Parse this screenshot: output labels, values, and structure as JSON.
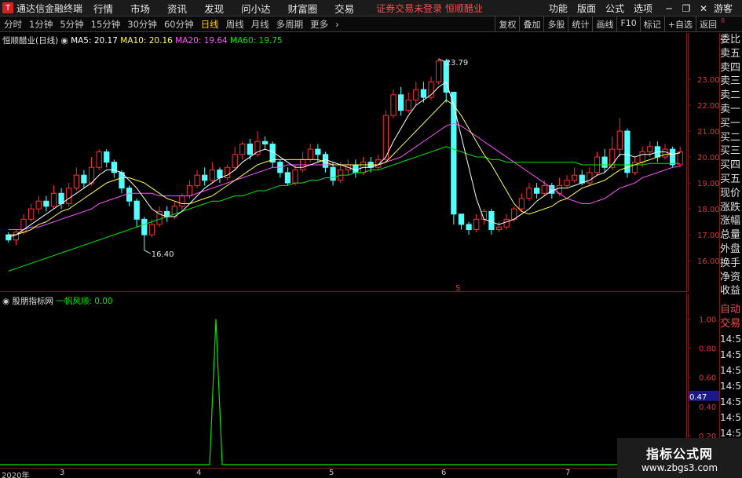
{
  "titlebar": {
    "logo": "T",
    "app_name": "通达信金融终端",
    "menus": [
      "行情",
      "市场",
      "资讯",
      "发现",
      "问小达",
      "财富圈",
      "交易"
    ],
    "warning": "证券交易未登录   恒顺醋业",
    "right_menus": [
      "功能",
      "版面",
      "公式",
      "选项"
    ],
    "user": "游客"
  },
  "toolbar": {
    "timeframes": [
      "分时",
      "1分钟",
      "5分钟",
      "15分钟",
      "30分钟",
      "60分钟",
      "日线",
      "周线",
      "月线",
      "多周期",
      "更多"
    ],
    "active": "日线",
    "right_buttons": [
      "复权",
      "叠加",
      "多股",
      "统计",
      "画线",
      "F10",
      "标记",
      "+自选",
      "返回"
    ]
  },
  "main_legend": {
    "name": "恒顺醋业(日线)",
    "ma5": "MA5: 20.17",
    "ma10": "MA10: 20.16",
    "ma20": "MA20: 19.64",
    "ma60": "MA60: 19.75"
  },
  "ind_legend": {
    "name": "股朋指标网",
    "line": "一帆风顺: 0.00"
  },
  "annotations": {
    "high": "23.79",
    "low": "16.40",
    "marker": "S"
  },
  "main_yaxis": [
    "23.00",
    "22.00",
    "21.00",
    "20.00",
    "19.00",
    "18.00",
    "17.00",
    "16.00"
  ],
  "ind_yaxis": [
    "1.00",
    "0.80",
    "0.60",
    "0.40",
    "0.20"
  ],
  "ind_current": "0.47",
  "right_panel": [
    "委比",
    "卖五",
    "卖四",
    "卖三",
    "卖二",
    "卖一",
    "买一",
    "买二",
    "买三",
    "买四",
    "买五",
    "现价",
    "涨跌",
    "涨幅",
    "总量",
    "外盘",
    "换手",
    "净资",
    "收益",
    "自动",
    "交易",
    "14:56",
    "14:56",
    "14:56",
    "14:56",
    "14:56",
    "14:56",
    "14:56",
    "14:56"
  ],
  "top_right_small": "8",
  "xaxis": [
    "2020年",
    "3",
    "4",
    "5",
    "6",
    "7"
  ],
  "watermark": {
    "line1": "指标公式网",
    "line2": "www.zbgs3.com"
  },
  "colors": {
    "up": "#ff3030",
    "down": "#54ffff",
    "ma5": "#ffffff",
    "ma10": "#ffff54",
    "ma20": "#ff54ff",
    "ma60": "#00e600",
    "ind": "#00e600",
    "axis": "#7a1c1c"
  },
  "chart_data": {
    "type": "candlestick",
    "ylim": [
      15.4,
      24.3
    ],
    "candles": [
      [
        17.0,
        16.8,
        17.1,
        16.7
      ],
      [
        16.8,
        17.1,
        17.2,
        16.6
      ],
      [
        17.1,
        17.6,
        17.8,
        17.0
      ],
      [
        17.6,
        18.0,
        18.2,
        17.5
      ],
      [
        18.0,
        18.3,
        18.5,
        17.8
      ],
      [
        18.3,
        18.1,
        18.5,
        17.9
      ],
      [
        18.1,
        18.6,
        18.9,
        18.0
      ],
      [
        18.6,
        18.2,
        18.8,
        18.0
      ],
      [
        18.2,
        18.8,
        19.0,
        18.1
      ],
      [
        18.8,
        19.3,
        19.6,
        18.7
      ],
      [
        19.3,
        19.0,
        19.5,
        18.8
      ],
      [
        19.0,
        19.6,
        20.0,
        18.9
      ],
      [
        19.6,
        20.2,
        20.3,
        19.5
      ],
      [
        20.2,
        19.8,
        20.3,
        19.6
      ],
      [
        19.8,
        19.4,
        19.9,
        19.2
      ],
      [
        19.4,
        18.8,
        19.5,
        18.6
      ],
      [
        18.8,
        18.3,
        18.9,
        18.1
      ],
      [
        18.3,
        17.6,
        18.4,
        17.3
      ],
      [
        17.6,
        17.0,
        17.7,
        16.4
      ],
      [
        17.0,
        17.4,
        17.6,
        16.9
      ],
      [
        17.4,
        17.9,
        18.1,
        17.3
      ],
      [
        17.9,
        17.7,
        18.1,
        17.5
      ],
      [
        17.7,
        18.1,
        18.3,
        17.6
      ],
      [
        18.1,
        18.5,
        18.6,
        17.9
      ],
      [
        18.5,
        18.9,
        19.1,
        18.4
      ],
      [
        18.9,
        19.3,
        19.5,
        18.8
      ],
      [
        19.3,
        19.1,
        19.6,
        18.9
      ],
      [
        19.1,
        19.5,
        19.8,
        19.0
      ],
      [
        19.5,
        19.2,
        19.6,
        19.0
      ],
      [
        19.2,
        19.6,
        19.7,
        19.1
      ],
      [
        19.6,
        20.1,
        20.4,
        19.5
      ],
      [
        20.1,
        20.5,
        20.6,
        19.9
      ],
      [
        20.5,
        20.1,
        20.7,
        19.9
      ],
      [
        20.1,
        20.6,
        21.0,
        20.0
      ],
      [
        20.6,
        20.5,
        20.8,
        20.3
      ],
      [
        20.5,
        19.8,
        20.6,
        19.6
      ],
      [
        19.8,
        19.4,
        19.9,
        19.2
      ],
      [
        19.4,
        19.0,
        19.6,
        18.9
      ],
      [
        19.0,
        19.5,
        19.7,
        18.9
      ],
      [
        19.5,
        19.9,
        20.2,
        19.4
      ],
      [
        19.9,
        20.3,
        20.5,
        19.8
      ],
      [
        20.3,
        20.1,
        20.5,
        19.8
      ],
      [
        20.1,
        19.6,
        20.2,
        19.4
      ],
      [
        19.6,
        19.1,
        19.8,
        18.9
      ],
      [
        19.1,
        19.5,
        19.8,
        19.0
      ],
      [
        19.5,
        19.7,
        19.9,
        19.3
      ],
      [
        19.7,
        19.4,
        19.9,
        19.2
      ],
      [
        19.4,
        19.8,
        20.0,
        19.3
      ],
      [
        19.8,
        19.6,
        20.0,
        19.4
      ],
      [
        19.6,
        19.9,
        20.1,
        19.5
      ],
      [
        19.9,
        21.6,
        21.8,
        19.8
      ],
      [
        21.6,
        22.4,
        22.6,
        21.5
      ],
      [
        22.4,
        21.8,
        22.7,
        21.6
      ],
      [
        21.8,
        22.2,
        22.5,
        21.7
      ],
      [
        22.2,
        22.6,
        22.9,
        22.0
      ],
      [
        22.6,
        22.3,
        22.9,
        22.1
      ],
      [
        22.3,
        22.9,
        23.1,
        22.2
      ],
      [
        22.9,
        23.7,
        23.79,
        22.8
      ],
      [
        23.7,
        22.5,
        23.79,
        22.1
      ],
      [
        22.5,
        17.8,
        17.9,
        17.4
      ],
      [
        17.8,
        17.4,
        17.8,
        17.2
      ],
      [
        17.4,
        17.2,
        17.5,
        17.0
      ],
      [
        17.2,
        17.6,
        17.8,
        17.1
      ],
      [
        17.6,
        17.9,
        18.0,
        17.4
      ],
      [
        17.9,
        17.2,
        18.0,
        17.0
      ],
      [
        17.2,
        17.3,
        17.5,
        17.1
      ],
      [
        17.3,
        17.6,
        17.8,
        17.2
      ],
      [
        17.6,
        18.0,
        18.1,
        17.5
      ],
      [
        18.0,
        18.4,
        18.6,
        17.9
      ],
      [
        18.4,
        18.8,
        19.0,
        18.3
      ],
      [
        18.8,
        18.6,
        19.0,
        18.4
      ],
      [
        18.6,
        18.9,
        19.1,
        18.5
      ],
      [
        18.9,
        18.6,
        19.0,
        18.4
      ],
      [
        18.6,
        18.9,
        19.2,
        18.5
      ],
      [
        18.9,
        19.1,
        19.3,
        18.8
      ],
      [
        19.1,
        19.3,
        19.6,
        19.0
      ],
      [
        19.3,
        19.0,
        19.5,
        18.9
      ],
      [
        19.0,
        19.4,
        19.6,
        18.9
      ],
      [
        19.4,
        20.0,
        20.2,
        19.3
      ],
      [
        20.0,
        19.6,
        20.3,
        19.4
      ],
      [
        19.6,
        20.3,
        20.8,
        19.5
      ],
      [
        20.3,
        21.0,
        21.5,
        20.0
      ],
      [
        21.0,
        19.4,
        21.1,
        19.2
      ],
      [
        19.4,
        19.8,
        20.0,
        19.3
      ],
      [
        19.8,
        20.2,
        20.4,
        19.6
      ],
      [
        20.2,
        20.4,
        20.6,
        20.0
      ],
      [
        20.4,
        20.0,
        20.6,
        19.8
      ],
      [
        20.0,
        20.3,
        20.5,
        19.9
      ],
      [
        20.3,
        19.7,
        20.4,
        19.6
      ],
      [
        19.7,
        20.2,
        20.4,
        19.6
      ]
    ],
    "ma5": [
      16.9,
      17.0,
      17.2,
      17.4,
      17.6,
      17.8,
      18.0,
      18.2,
      18.4,
      18.6,
      18.8,
      19.0,
      19.3,
      19.5,
      19.5,
      19.4,
      19.1,
      18.8,
      18.4,
      18.0,
      17.8,
      17.7,
      17.7,
      17.9,
      18.2,
      18.5,
      18.8,
      19.0,
      19.2,
      19.3,
      19.5,
      19.8,
      20.0,
      20.2,
      20.3,
      20.2,
      20.0,
      19.8,
      19.6,
      19.6,
      19.7,
      19.8,
      19.9,
      19.8,
      19.7,
      19.6,
      19.5,
      19.6,
      19.6,
      19.7,
      20.0,
      20.6,
      21.1,
      21.6,
      22.0,
      22.2,
      22.4,
      22.7,
      22.9,
      22.0,
      20.8,
      19.6,
      18.4,
      17.6,
      17.5,
      17.4,
      17.5,
      17.6,
      17.8,
      18.0,
      18.3,
      18.5,
      18.7,
      18.8,
      18.8,
      18.9,
      19.0,
      19.1,
      19.3,
      19.4,
      19.7,
      20.1,
      20.1,
      20.0,
      20.1,
      20.1,
      20.2,
      20.2,
      20.1,
      20.17
    ],
    "ma10": [
      17.0,
      17.0,
      17.1,
      17.2,
      17.4,
      17.5,
      17.7,
      17.9,
      18.0,
      18.2,
      18.4,
      18.6,
      18.8,
      19.0,
      19.1,
      19.2,
      19.2,
      19.1,
      19.0,
      18.8,
      18.6,
      18.4,
      18.3,
      18.2,
      18.2,
      18.3,
      18.4,
      18.5,
      18.7,
      18.9,
      19.1,
      19.3,
      19.5,
      19.7,
      19.8,
      19.9,
      19.9,
      19.9,
      19.9,
      19.9,
      19.9,
      19.9,
      19.8,
      19.7,
      19.7,
      19.7,
      19.7,
      19.7,
      19.7,
      19.7,
      19.8,
      20.1,
      20.4,
      20.7,
      21.0,
      21.3,
      21.6,
      21.9,
      22.2,
      22.0,
      21.6,
      21.1,
      20.6,
      20.1,
      19.7,
      19.2,
      18.7,
      18.2,
      17.9,
      17.8,
      17.9,
      18.0,
      18.1,
      18.3,
      18.4,
      18.6,
      18.8,
      18.9,
      19.0,
      19.1,
      19.3,
      19.5,
      19.6,
      19.7,
      19.8,
      19.9,
      20.0,
      20.1,
      20.1,
      20.16
    ],
    "ma20": [
      17.2,
      17.2,
      17.2,
      17.3,
      17.3,
      17.4,
      17.5,
      17.6,
      17.7,
      17.8,
      17.9,
      18.0,
      18.2,
      18.3,
      18.4,
      18.5,
      18.6,
      18.6,
      18.6,
      18.6,
      18.5,
      18.5,
      18.5,
      18.5,
      18.5,
      18.6,
      18.7,
      18.8,
      18.9,
      19.0,
      19.1,
      19.2,
      19.3,
      19.4,
      19.5,
      19.6,
      19.6,
      19.7,
      19.7,
      19.7,
      19.7,
      19.7,
      19.7,
      19.7,
      19.7,
      19.7,
      19.7,
      19.7,
      19.7,
      19.7,
      19.8,
      19.9,
      20.0,
      20.2,
      20.4,
      20.6,
      20.8,
      21.0,
      21.2,
      21.3,
      21.2,
      21.0,
      20.8,
      20.6,
      20.4,
      20.2,
      20.0,
      19.8,
      19.6,
      19.4,
      19.2,
      19.0,
      18.8,
      18.6,
      18.4,
      18.3,
      18.2,
      18.2,
      18.3,
      18.4,
      18.6,
      18.8,
      18.9,
      19.0,
      19.2,
      19.3,
      19.4,
      19.5,
      19.6,
      19.64
    ],
    "ma60": [
      15.6,
      15.7,
      15.8,
      15.9,
      16.0,
      16.1,
      16.2,
      16.3,
      16.4,
      16.5,
      16.6,
      16.7,
      16.8,
      16.9,
      17.0,
      17.1,
      17.2,
      17.3,
      17.4,
      17.5,
      17.6,
      17.7,
      17.8,
      17.9,
      18.0,
      18.1,
      18.2,
      18.3,
      18.3,
      18.4,
      18.5,
      18.5,
      18.6,
      18.7,
      18.7,
      18.8,
      18.9,
      18.9,
      19.0,
      19.0,
      19.1,
      19.1,
      19.2,
      19.2,
      19.3,
      19.3,
      19.4,
      19.4,
      19.5,
      19.5,
      19.6,
      19.7,
      19.8,
      19.9,
      20.0,
      20.1,
      20.2,
      20.3,
      20.4,
      20.3,
      20.2,
      20.1,
      20.0,
      20.0,
      19.9,
      19.9,
      19.8,
      19.8,
      19.8,
      19.8,
      19.8,
      19.8,
      19.8,
      19.8,
      19.8,
      19.8,
      19.7,
      19.7,
      19.7,
      19.7,
      19.7,
      19.7,
      19.7,
      19.7,
      19.7,
      19.75,
      19.75,
      19.75,
      19.75,
      19.75
    ],
    "indicator": {
      "name": "一帆风顺",
      "ylim": [
        0,
        1.1
      ],
      "spike_index": 30,
      "value": 1.0
    }
  }
}
